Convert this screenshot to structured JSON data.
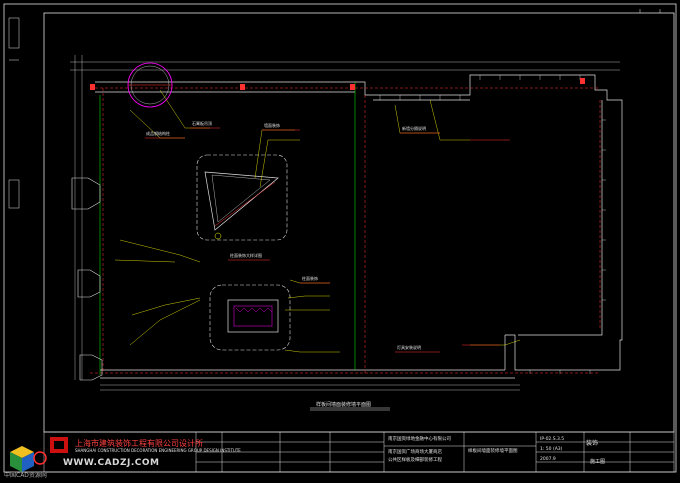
{
  "colors": {
    "background": "#000000",
    "frame": "#e0e0e0",
    "wall": "#e0e0e0",
    "grid": "#00ff00",
    "accent_red": "#ff3030",
    "leader_yellow": "#ffff00",
    "magenta": "#ff00ff",
    "cyan": "#00ffff"
  },
  "title_block": {
    "company_cn": "上海市建筑装饰工程有限公司设计所",
    "company_en": "SHANGHAI CONSTRUCTION DECORATION ENGINEERING GROUP DESIGN INSTITUTE",
    "client": "南京国资绿地金融中心有限公司",
    "project": "南京国资广场商场大厦商店",
    "project2": "公共区样板及细部装修工程",
    "sheet_title": "样板间墙面装修墙平面图",
    "drawing_no": "IP-02.S.3.5",
    "scale": "1: 50 (A3)",
    "date": "2007.9",
    "phase": "施工图",
    "sheet_no": "装饰"
  },
  "plan_title": "样板间墙面装修墙平面图",
  "watermark": {
    "site": "WWW.CADZJ.COM",
    "cn": "中国CAD资源网"
  },
  "callouts": [
    "成品钢结构柱",
    "石膏板吊顶",
    "柱面装饰大样详图",
    "柱面装饰",
    "墙面装饰",
    "新墙分隔说明",
    "灯具安装说明"
  ]
}
